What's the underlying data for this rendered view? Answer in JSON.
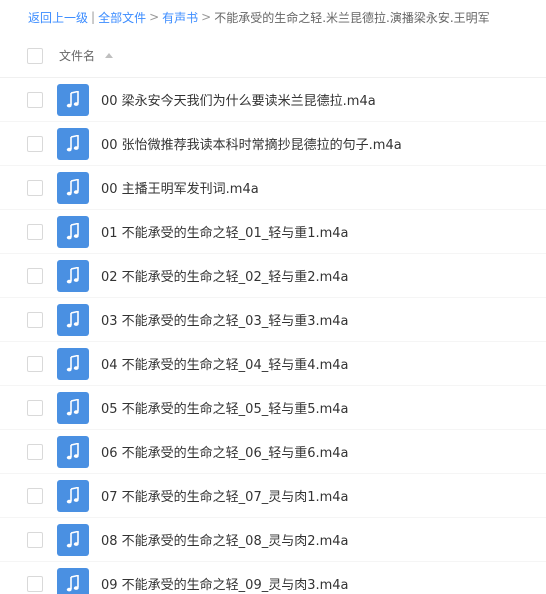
{
  "breadcrumb": {
    "back": "返回上一级",
    "root": "全部文件",
    "parent": "有声书",
    "current": "不能承受的生命之轻.米兰昆德拉.演播梁永安.王明军",
    "separator_pipe": "|",
    "separator_arrow": ">"
  },
  "header": {
    "name_label": "文件名"
  },
  "files": [
    {
      "name": "00 梁永安今天我们为什么要读米兰昆德拉.m4a"
    },
    {
      "name": "00 张怡微推荐我读本科时常摘抄昆德拉的句子.m4a"
    },
    {
      "name": "00 主播王明军发刊词.m4a"
    },
    {
      "name": "01 不能承受的生命之轻_01_轻与重1.m4a"
    },
    {
      "name": "02 不能承受的生命之轻_02_轻与重2.m4a"
    },
    {
      "name": "03 不能承受的生命之轻_03_轻与重3.m4a"
    },
    {
      "name": "04 不能承受的生命之轻_04_轻与重4.m4a"
    },
    {
      "name": "05 不能承受的生命之轻_05_轻与重5.m4a"
    },
    {
      "name": "06 不能承受的生命之轻_06_轻与重6.m4a"
    },
    {
      "name": "07 不能承受的生命之轻_07_灵与肉1.m4a"
    },
    {
      "name": "08 不能承受的生命之轻_08_灵与肉2.m4a"
    },
    {
      "name": "09 不能承受的生命之轻_09_灵与肉3.m4a"
    }
  ],
  "icons": {
    "file_type": "music-note-icon",
    "sort": "sort-ascending-icon"
  },
  "colors": {
    "link": "#3b8cff",
    "file_icon_bg": "#4a90e2"
  }
}
